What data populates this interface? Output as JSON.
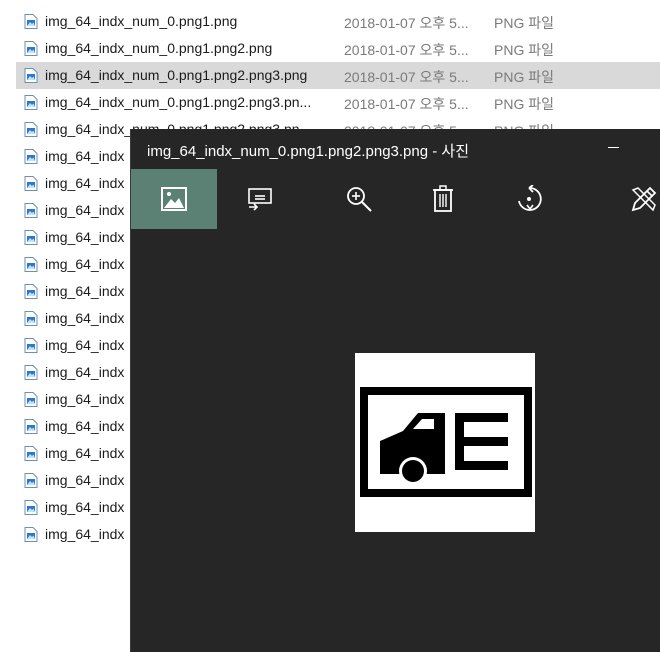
{
  "explorer": {
    "rows": [
      {
        "name": "img_64_indx_num_0.png1.png",
        "date": "2018-01-07 오후 5...",
        "type": "PNG 파일",
        "selected": false
      },
      {
        "name": "img_64_indx_num_0.png1.png2.png",
        "date": "2018-01-07 오후 5...",
        "type": "PNG 파일",
        "selected": false
      },
      {
        "name": "img_64_indx_num_0.png1.png2.png3.png",
        "date": "2018-01-07 오후 5...",
        "type": "PNG 파일",
        "selected": true
      },
      {
        "name": "img_64_indx_num_0.png1.png2.png3.pn...",
        "date": "2018-01-07 오후 5...",
        "type": "PNG 파일",
        "selected": false
      },
      {
        "name": "img_64_indx_num_0.png1.png2.png3.pn...",
        "date": "2018-01-07 오후 5...",
        "type": "PNG 파일",
        "selected": false
      },
      {
        "name": "img_64_indx",
        "date": "",
        "type": "",
        "selected": false
      },
      {
        "name": "img_64_indx",
        "date": "",
        "type": "",
        "selected": false
      },
      {
        "name": "img_64_indx",
        "date": "",
        "type": "",
        "selected": false
      },
      {
        "name": "img_64_indx",
        "date": "",
        "type": "",
        "selected": false
      },
      {
        "name": "img_64_indx",
        "date": "",
        "type": "",
        "selected": false
      },
      {
        "name": "img_64_indx",
        "date": "",
        "type": "",
        "selected": false
      },
      {
        "name": "img_64_indx",
        "date": "",
        "type": "",
        "selected": false
      },
      {
        "name": "img_64_indx",
        "date": "",
        "type": "",
        "selected": false
      },
      {
        "name": "img_64_indx",
        "date": "",
        "type": "",
        "selected": false
      },
      {
        "name": "img_64_indx",
        "date": "",
        "type": "",
        "selected": false
      },
      {
        "name": "img_64_indx",
        "date": "",
        "type": "",
        "selected": false
      },
      {
        "name": "img_64_indx",
        "date": "",
        "type": "",
        "selected": false
      },
      {
        "name": "img_64_indx",
        "date": "",
        "type": "",
        "selected": false
      },
      {
        "name": "img_64_indx",
        "date": "",
        "type": "",
        "selected": false
      },
      {
        "name": "img_64_indx",
        "date": "",
        "type": "",
        "selected": false
      }
    ]
  },
  "viewer": {
    "title": "img_64_indx_num_0.png1.png2.png3.png - 사진",
    "toolbar": [
      {
        "name": "collection-button",
        "icon": "image-icon",
        "active": true
      },
      {
        "name": "slideshow-button",
        "icon": "slideshow-icon",
        "active": false
      },
      {
        "name": "zoom-button",
        "icon": "zoom-in-icon",
        "active": false
      },
      {
        "name": "delete-button",
        "icon": "trash-icon",
        "active": false
      },
      {
        "name": "rotate-button",
        "icon": "rotate-icon",
        "active": false
      },
      {
        "name": "edit-button",
        "icon": "edit-pen-icon",
        "active": false
      }
    ]
  },
  "colors": {
    "viewer_bg": "#262626",
    "active_button": "#5b8074",
    "selection": "#d9d9d9"
  }
}
